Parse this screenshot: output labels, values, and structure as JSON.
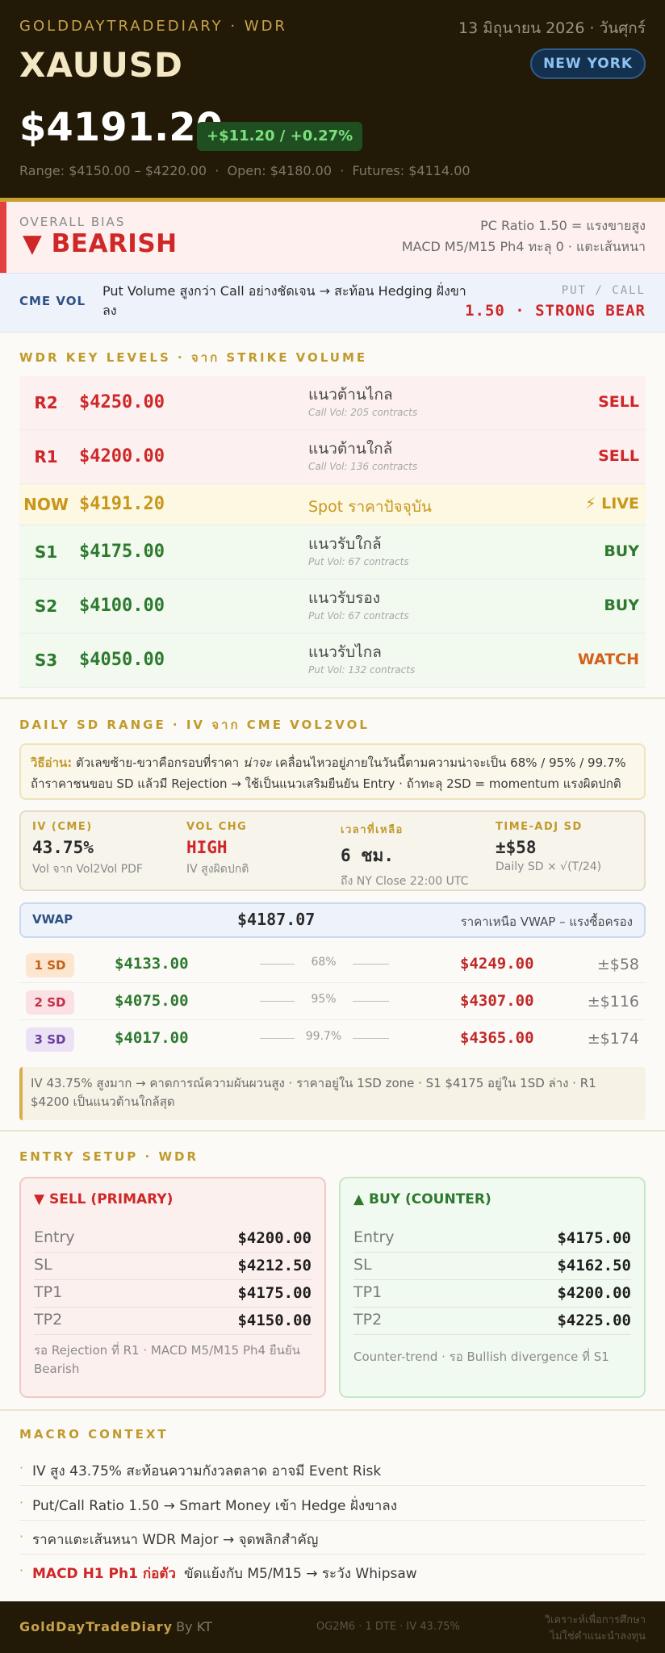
{
  "colors": {
    "header_bg": "#221a07",
    "gold": "#c9a02f",
    "bear_red": "#cf2727",
    "bull_green": "#2d7a2f",
    "watch_orange": "#d4601a",
    "live_gold": "#c9961a"
  },
  "header": {
    "brand": "GOLDDAYTRADEDIARY · WDR",
    "date": "13 มิถุนายน 2026 · วันศุกร์",
    "symbol": "XAUUSD",
    "session_badge": "NEW YORK",
    "price": "$4191.20",
    "change": "+$11.20 / +0.27%",
    "subinfo": "Range: $4150.00 – $4220.00  ·  Open: $4180.00  ·  Futures: $4114.00"
  },
  "bias": {
    "label": "OVERALL BIAS",
    "value": "▼ BEARISH",
    "right_line1": "PC Ratio 1.50 = แรงขายสูง",
    "right_line2": "MACD M5/M15 Ph4 ทะลุ 0 · แตะเส้นหนา"
  },
  "cme_vol": {
    "label": "CME VOL",
    "text": "Put Volume สูงกว่า Call อย่างชัดเจน → สะท้อน Hedging ฝั่งขาลง",
    "right_label": "PUT / CALL",
    "right_value": "1.50 · STRONG BEAR"
  },
  "key_levels": {
    "title": "WDR KEY LEVELS · จาก STRIKE VOLUME",
    "rows": [
      {
        "tag": "R2",
        "price": "$4250.00",
        "desc": "แนวต้านไกล",
        "sub": "Call Vol: 205 contracts",
        "action": "SELL"
      },
      {
        "tag": "R1",
        "price": "$4200.00",
        "desc": "แนวต้านใกล้",
        "sub": "Call Vol: 136 contracts",
        "action": "SELL"
      },
      {
        "tag": "NOW",
        "price": "$4191.20",
        "desc": "Spot ราคาปัจจุบัน",
        "sub": "",
        "action": "⚡ LIVE"
      },
      {
        "tag": "S1",
        "price": "$4175.00",
        "desc": "แนวรับใกล้",
        "sub": "Put Vol: 67 contracts",
        "action": "BUY"
      },
      {
        "tag": "S2",
        "price": "$4100.00",
        "desc": "แนวรับรอง",
        "sub": "Put Vol: 67 contracts",
        "action": "BUY"
      },
      {
        "tag": "S3",
        "price": "$4050.00",
        "desc": "แนวรับไกล",
        "sub": "Put Vol: 132 contracts",
        "action": "WATCH"
      }
    ]
  },
  "sd_range": {
    "title": "DAILY SD RANGE · IV จาก CME VOL2VOL",
    "explain_lead": "วิธีอ่าน:",
    "explain_line1_a": " ตัวเลขซ้าย-ขวาคือกรอบที่ราคา ",
    "explain_line1_em": "น่าจะ",
    "explain_line1_b": " เคลื่อนไหวอยู่ภายในวันนี้ตามความน่าจะเป็น 68% / 95% / 99.7%",
    "explain_line2": "ถ้าราคาชนขอบ SD แล้วมี Rejection → ใช้เป็นแนวเสริมยืนยัน Entry · ถ้าทะลุ 2SD = momentum แรงผิดปกติ",
    "iv_stats": [
      {
        "key": "IV (CME)",
        "value": "43.75%",
        "sub": "Vol จาก Vol2Vol PDF"
      },
      {
        "key": "VOL CHG",
        "value": "HIGH",
        "sub": "IV สูงผิดปกติ"
      },
      {
        "key": "เวลาที่เหลือ",
        "value": "6 ชม.",
        "sub": "ถึง NY Close 22:00 UTC"
      },
      {
        "key": "TIME-ADJ SD",
        "value": "±$58",
        "sub": "Daily SD × √(T/24)"
      }
    ],
    "vwap_label": "VWAP",
    "vwap_value": "$4187.07",
    "vwap_note": "ราคาเหนือ VWAP – แรงซื้อครอง",
    "bands": [
      {
        "label": "1 SD",
        "low": "$4133.00",
        "pct": "68%",
        "high": "$4249.00",
        "pm": "±$58"
      },
      {
        "label": "2 SD",
        "low": "$4075.00",
        "pct": "95%",
        "high": "$4307.00",
        "pm": "±$116"
      },
      {
        "label": "3 SD",
        "low": "$4017.00",
        "pct": "99.7%",
        "high": "$4365.00",
        "pm": "±$174"
      }
    ],
    "note": "IV 43.75% สูงมาก → คาดการณ์ความผันผวนสูง · ราคาอยู่ใน 1SD zone · S1 $4175 อยู่ใน 1SD ล่าง · R1 $4200 เป็นแนวต้านใกล้สุด"
  },
  "entry": {
    "title": "ENTRY SETUP · WDR",
    "sell": {
      "title": "▼ SELL (PRIMARY)",
      "rows": [
        {
          "label": "Entry",
          "value": "$4200.00"
        },
        {
          "label": "SL",
          "value": "$4212.50"
        },
        {
          "label": "TP1",
          "value": "$4175.00"
        },
        {
          "label": "TP2",
          "value": "$4150.00"
        }
      ],
      "note": "รอ Rejection ที่ R1 · MACD M5/M15 Ph4 ยืนยัน Bearish"
    },
    "buy": {
      "title": "▲ BUY (COUNTER)",
      "rows": [
        {
          "label": "Entry",
          "value": "$4175.00"
        },
        {
          "label": "SL",
          "value": "$4162.50"
        },
        {
          "label": "TP1",
          "value": "$4200.00"
        },
        {
          "label": "TP2",
          "value": "$4225.00"
        }
      ],
      "note": "Counter-trend · รอ Bullish divergence ที่ S1"
    }
  },
  "macro": {
    "title": "MACRO CONTEXT",
    "items": [
      {
        "highlight": "",
        "text": "IV สูง 43.75% สะท้อนความกังวลตลาด อาจมี Event Risk"
      },
      {
        "highlight": "",
        "text": "Put/Call Ratio 1.50 → Smart Money เข้า Hedge ฝั่งขาลง"
      },
      {
        "highlight": "",
        "text": "ราคาแตะเส้นหนา WDR Major → จุดพลิกสำคัญ"
      },
      {
        "highlight": "MACD H1 Ph1 ก่อตัว",
        "text": "ขัดแย้งกับ M5/M15 → ระวัง Whipsaw"
      }
    ]
  },
  "footer": {
    "brand": "GoldDayTradeDiary",
    "by": "· By KT",
    "mid": "OG2M6 · 1 DTE · IV 43.75%",
    "disclaimer1": "วิเคราะห์เพื่อการศึกษา",
    "disclaimer2": "ไม่ใช่คำแนะนำลงทุน"
  }
}
